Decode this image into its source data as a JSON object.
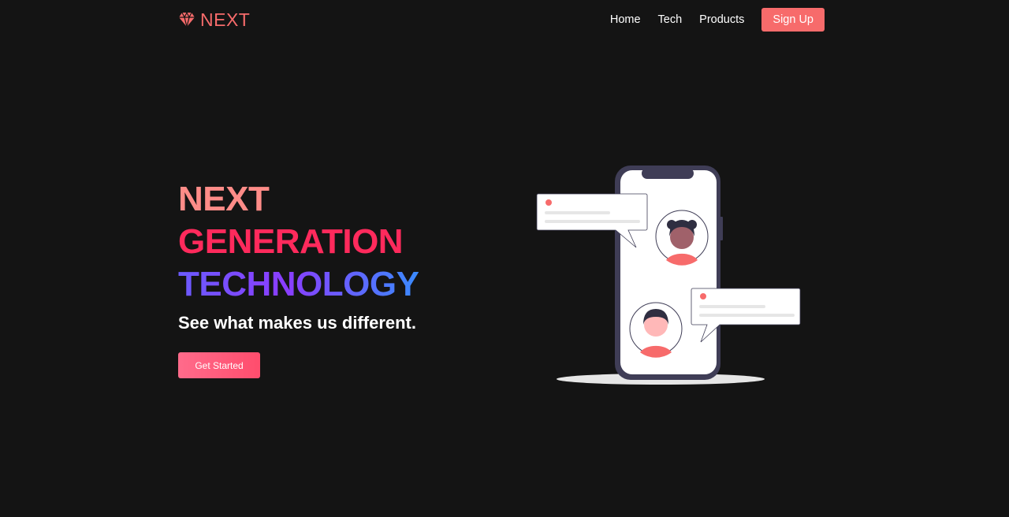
{
  "brand": {
    "name": "NEXT",
    "icon": "diamond-icon",
    "color": "#f76b6b"
  },
  "nav": {
    "links": [
      "Home",
      "Tech",
      "Products"
    ],
    "cta": "Sign Up"
  },
  "hero": {
    "line1": "NEXT",
    "line2": "GENERATION",
    "line3": "TECHNOLOGY",
    "subtitle": "See what makes us different.",
    "button": "Get Started"
  },
  "colors": {
    "background": "#141414",
    "accent": "#f76b6b",
    "line1": "#ff8c88",
    "line2": "#ff2a5c",
    "line3_gradient": [
      "#6b5bff",
      "#8a3dff",
      "#3a8bff"
    ]
  },
  "illustration": {
    "subject": "phone-chat-illustration"
  }
}
